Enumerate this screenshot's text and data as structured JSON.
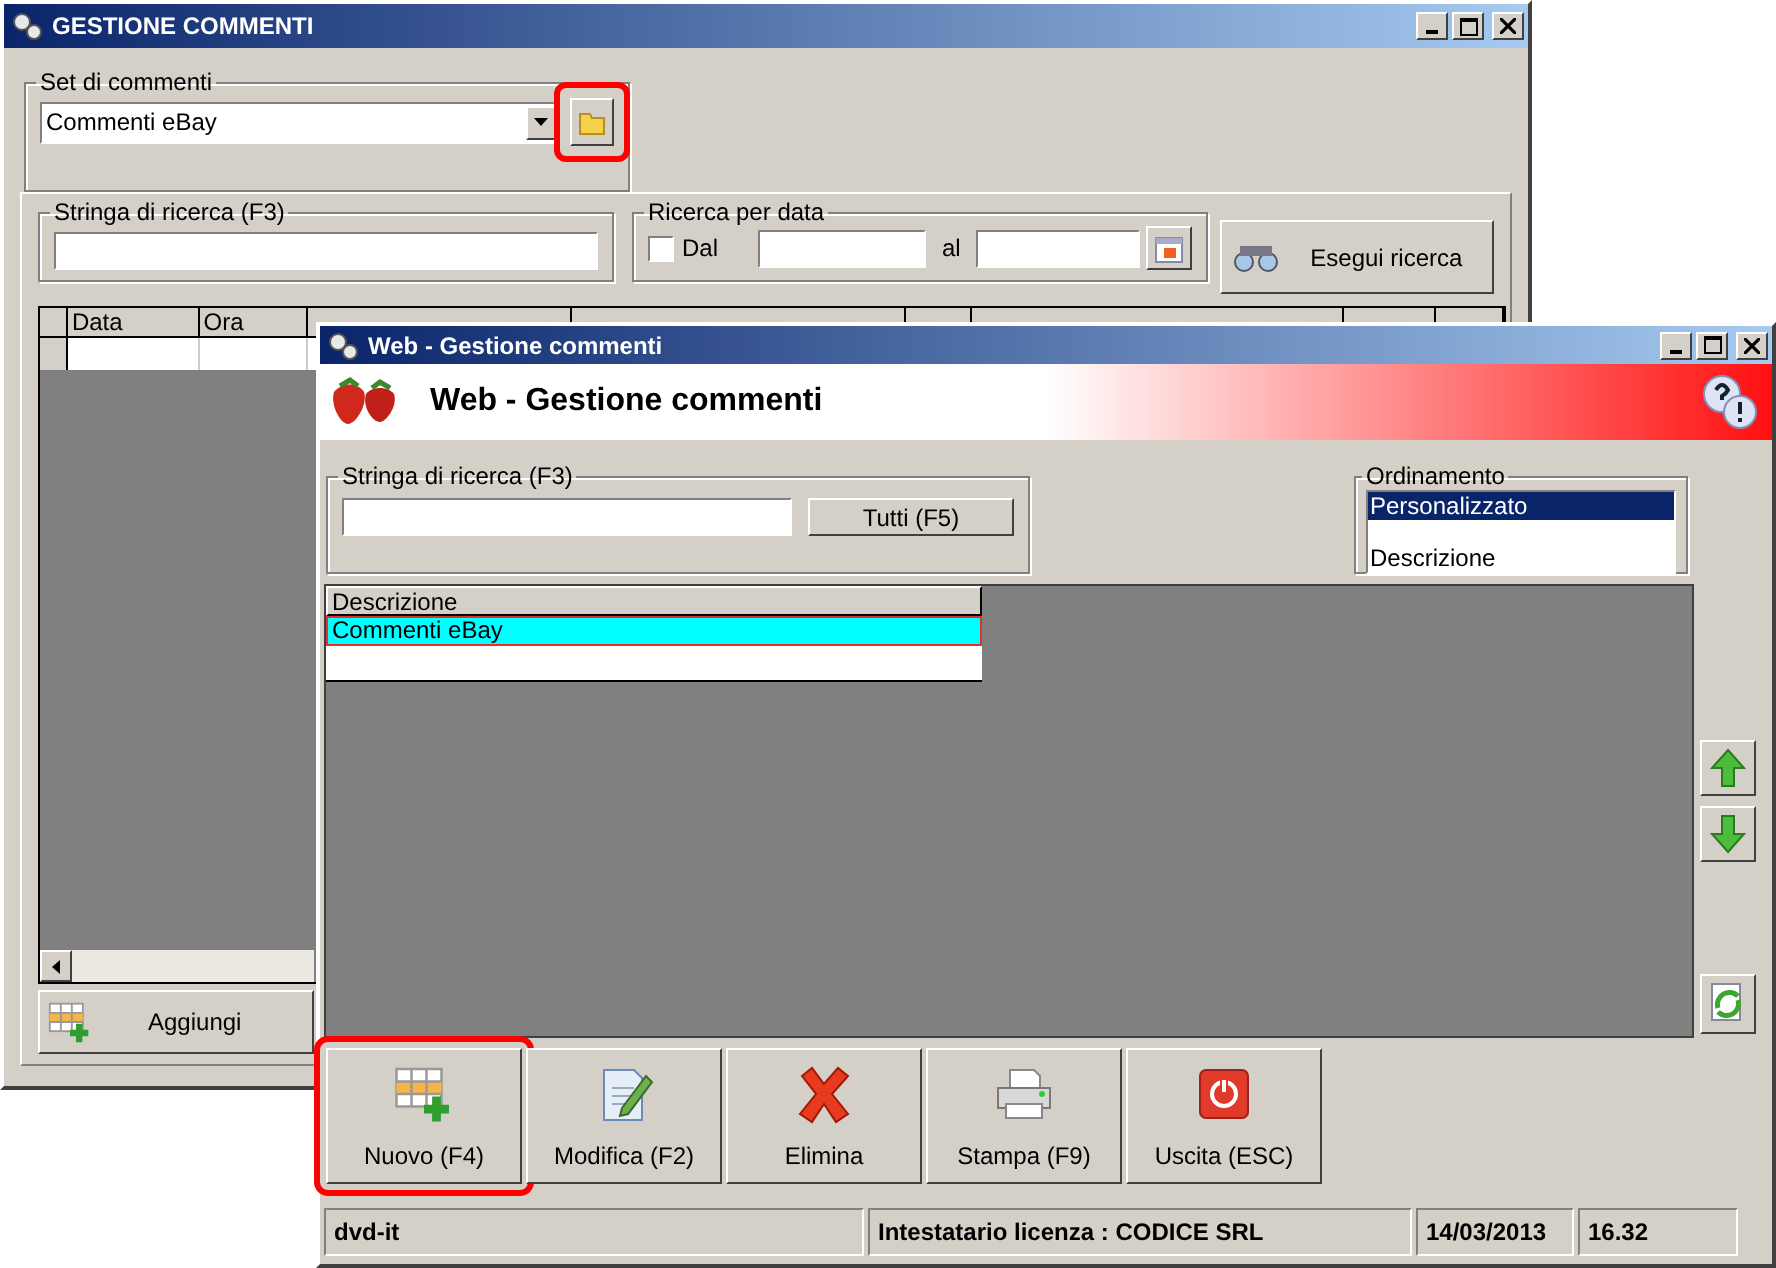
{
  "back_window": {
    "title": "GESTIONE COMMENTI",
    "comment_set": {
      "label": "Set di commenti",
      "value": "Commenti eBay",
      "button_highlighted": true
    },
    "search": {
      "label": "Stringa di ricerca (F3)"
    },
    "date_search": {
      "label": "Ricerca per data",
      "from_label": "Dal",
      "from_checked": false,
      "to_label": "al"
    },
    "search_button": "Esegui ricerca",
    "table": {
      "columns": [
        "Data",
        "Ora"
      ]
    },
    "add_button": "Aggiungi"
  },
  "front_window": {
    "title": "Web - Gestione commenti",
    "banner_title": "Web - Gestione commenti",
    "search": {
      "label": "Stringa di ricerca (F3)"
    },
    "all_button": "Tutti (F5)",
    "sorting": {
      "label": "Ordinamento",
      "options": [
        {
          "label": "Personalizzato",
          "selected": true
        },
        {
          "label": "Descrizione",
          "selected": false
        }
      ]
    },
    "list": {
      "column": "Descrizione",
      "rows": [
        {
          "label": "Commenti eBay",
          "selected": true
        }
      ]
    },
    "buttons": [
      {
        "label": "Nuovo (F4)",
        "kind": "new",
        "highlighted": true
      },
      {
        "label": "Modifica (F2)",
        "kind": "edit",
        "highlighted": false
      },
      {
        "label": "Elimina",
        "kind": "delete",
        "highlighted": false
      },
      {
        "label": "Stampa (F9)",
        "kind": "print",
        "highlighted": false
      },
      {
        "label": "Uscita (ESC)",
        "kind": "exit",
        "highlighted": false
      }
    ],
    "status_bar": [
      "dvd-it",
      "Intestatario licenza : CODICE SRL",
      "14/03/2013",
      "16.32"
    ]
  }
}
